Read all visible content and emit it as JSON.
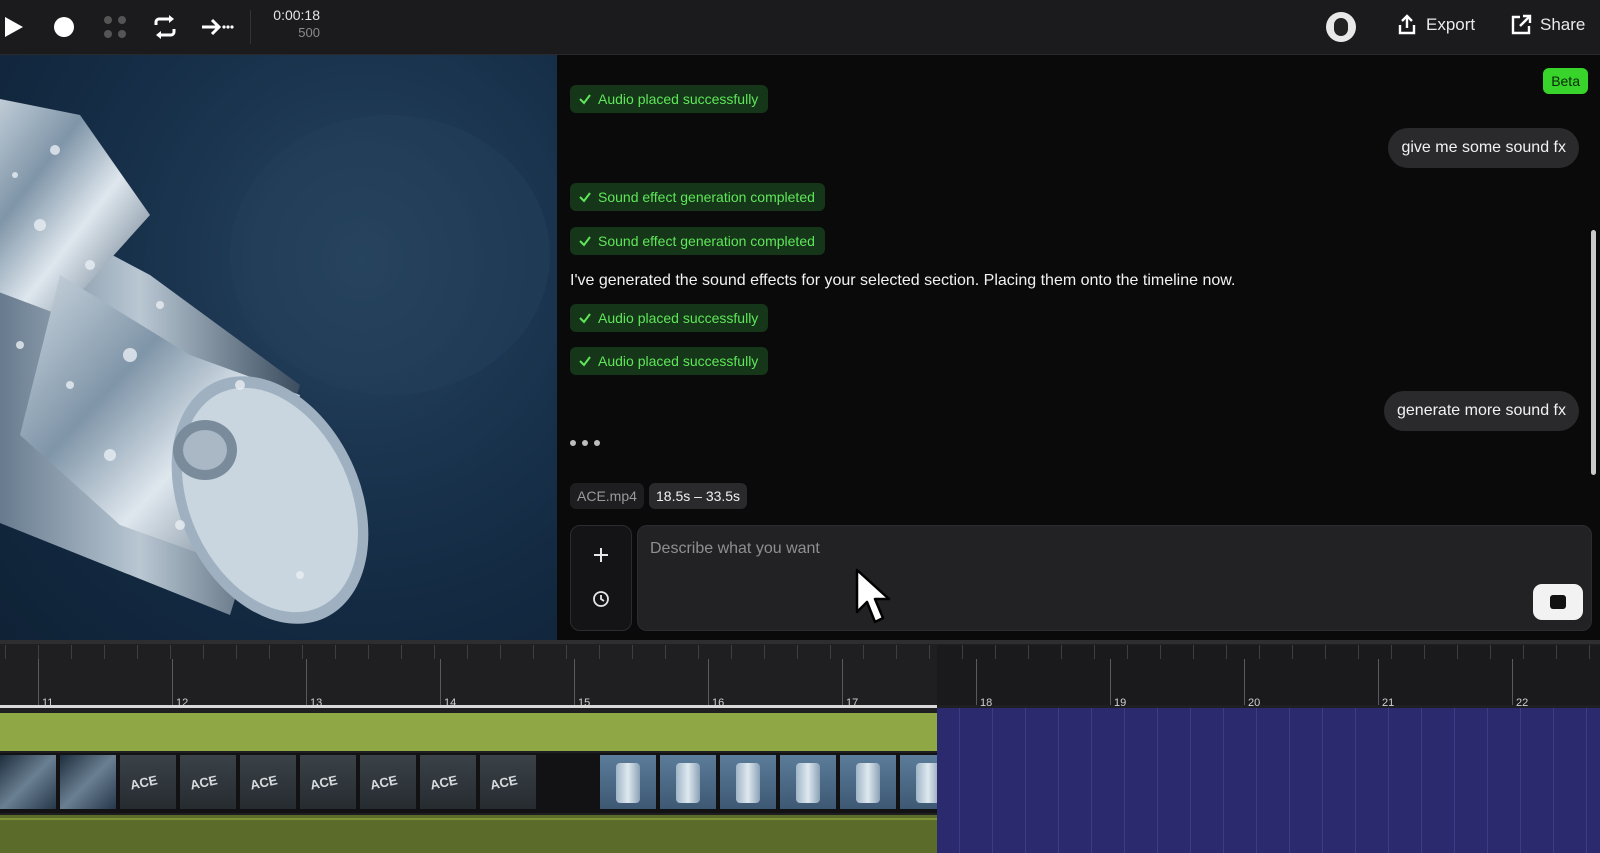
{
  "toolbar": {
    "timecode": "0:00:18",
    "frame": "500",
    "export_label": "Export",
    "share_label": "Share"
  },
  "chat": {
    "beta_label": "Beta",
    "statuses": [
      "Audio placed successfully",
      "Sound effect generation completed",
      "Sound effect generation completed",
      "Audio placed successfully",
      "Audio placed successfully"
    ],
    "user_messages": [
      "give me some sound fx",
      "generate more sound fx"
    ],
    "assistant_message": "I've generated the sound effects for your selected section. Placing them onto the timeline now.",
    "context_file": "ACE.mp4",
    "context_range": "18.5s – 33.5s",
    "input_placeholder": "Describe what you want"
  },
  "timeline": {
    "labels": [
      "11",
      "12",
      "13",
      "14",
      "15",
      "16",
      "17",
      "18",
      "19",
      "20",
      "21",
      "22"
    ]
  },
  "colors": {
    "accent_green": "#39d42b",
    "status_bg": "#153618",
    "status_text": "#5fe65a",
    "audio_track": "#8fa845",
    "selection": "#2b2a6e"
  }
}
